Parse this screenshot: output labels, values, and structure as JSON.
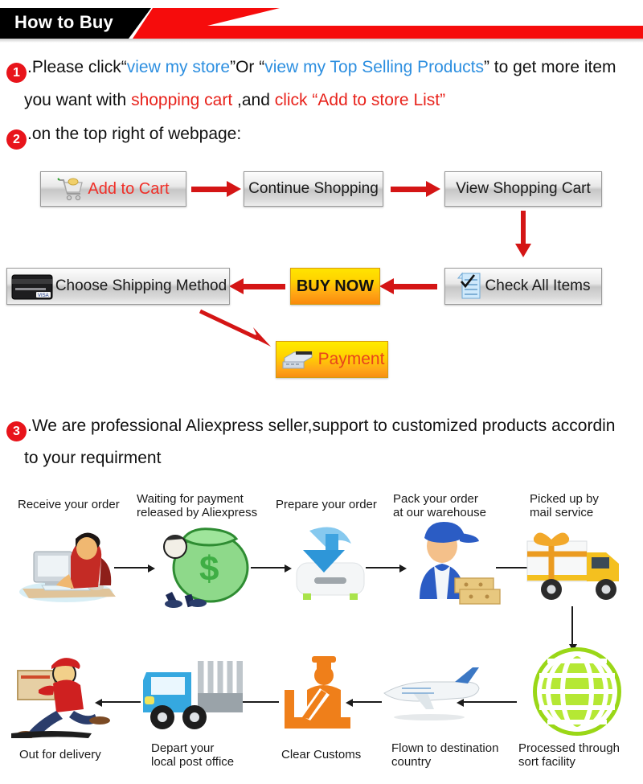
{
  "header": {
    "title": "How to Buy",
    "black_color": "#000000",
    "red_color": "#f60c0c"
  },
  "steps": {
    "step1": {
      "number": "1",
      "line1_a": ".Please click",
      "line1_quote_open": "“",
      "line1_link1": "view my store",
      "line1_b": "”Or “",
      "line1_link2": "view my Top Selling Products",
      "line1_c": "” to get more item",
      "line2_a": "you want with ",
      "line2_red1": "shopping cart",
      "line2_b": " ,and ",
      "line2_red2": "click “Add to store List”"
    },
    "step2": {
      "number": "2",
      "text": ".on the top right of webpage:"
    },
    "step3": {
      "number": "3",
      "line1": ".We are professional Aliexpress seller,support to customized products accordin",
      "line2": "to your requirment"
    }
  },
  "flow_buttons": {
    "add_to_cart": {
      "label": "Add to Cart",
      "icon": "shopping-cart-icon"
    },
    "continue_shopping": {
      "label": "Continue Shopping"
    },
    "view_shopping_cart": {
      "label": "View Shopping Cart"
    },
    "check_all_items": {
      "label": "Check All Items",
      "icon": "checklist-icon"
    },
    "buy_now": {
      "label": "BUY NOW"
    },
    "choose_shipping_method": {
      "label": "Choose Shipping Method",
      "icon": "credit-card-icon"
    },
    "payment": {
      "label": "Payment",
      "icon": "cash-register-icon"
    }
  },
  "shipping_flow": {
    "row1": [
      {
        "label_line1": "Receive your order",
        "label_line2": "",
        "icon": "person-at-computer-icon"
      },
      {
        "label_line1": "Waiting for payment",
        "label_line2": "released by Aliexpress",
        "icon": "money-bag-icon"
      },
      {
        "label_line1": "Prepare your order",
        "label_line2": "",
        "icon": "download-arrow-icon"
      },
      {
        "label_line1": "Pack your order",
        "label_line2": "at our warehouse",
        "icon": "warehouse-worker-icon"
      },
      {
        "label_line1": "Picked up by",
        "label_line2": "mail service",
        "icon": "delivery-truck-gift-icon"
      }
    ],
    "row2": [
      {
        "label_line1": "Out for delivery",
        "label_line2": "",
        "icon": "running-courier-icon"
      },
      {
        "label_line1": "Depart your",
        "label_line2": "local post office",
        "icon": "post-truck-icon"
      },
      {
        "label_line1": "Clear Customs",
        "label_line2": "",
        "icon": "customs-officer-icon"
      },
      {
        "label_line1": "Flown to destination",
        "label_line2": "country",
        "icon": "airplane-icon"
      },
      {
        "label_line1": "Processed through",
        "label_line2": "sort facility",
        "icon": "globe-sort-icon"
      }
    ]
  },
  "colors": {
    "accent_red": "#e8141b",
    "arrow_red": "#d41515",
    "link_blue": "#2d8fe0",
    "buy_now_orange": "#ffa415",
    "globe_green": "#8fd71b"
  }
}
